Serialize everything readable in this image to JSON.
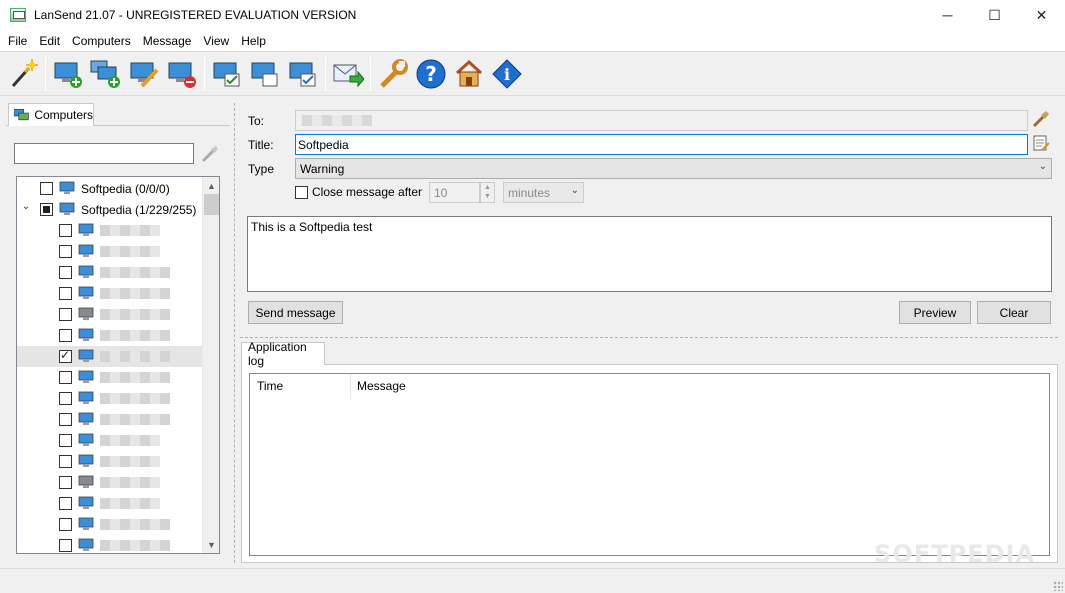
{
  "window": {
    "title": "LanSend 21.07 - UNREGISTERED EVALUATION VERSION"
  },
  "menu": [
    "File",
    "Edit",
    "Computers",
    "Message",
    "View",
    "Help"
  ],
  "toolbar": {
    "buttons": [
      "wizard-icon",
      "add-computer-icon",
      "add-group-icon",
      "edit-computer-icon",
      "remove-computer-icon",
      "check-all-icon",
      "uncheck-all-icon",
      "invert-check-icon",
      "send-message-icon",
      "settings-icon",
      "help-icon",
      "homepage-icon",
      "about-icon"
    ]
  },
  "left": {
    "tab_label": "Computers",
    "search_value": "",
    "tree": [
      {
        "label": "Softpedia (0/0/0)",
        "level": 0,
        "expander": "",
        "check": "unchecked"
      },
      {
        "label": "Softpedia (1/229/255)",
        "level": 0,
        "expander": "⌄",
        "check": "partial"
      }
    ],
    "children_count": 16,
    "checked_child_index": 6
  },
  "form": {
    "to_label": "To:",
    "title_label": "Title:",
    "title_value": "Softpedia",
    "type_label": "Type",
    "type_value": "Warning",
    "close_after_label": "Close message after",
    "close_after_value": "10",
    "close_unit": "minutes",
    "message_text": "This is a Softpedia test",
    "send_label": "Send message",
    "preview_label": "Preview",
    "clear_label": "Clear"
  },
  "log": {
    "tab_label": "Application log",
    "columns": [
      "Time",
      "Message"
    ]
  },
  "colors": {
    "accent": "#0078d7",
    "selected_row": "#e5e5e5"
  },
  "watermark": "SOFTPEDIA"
}
